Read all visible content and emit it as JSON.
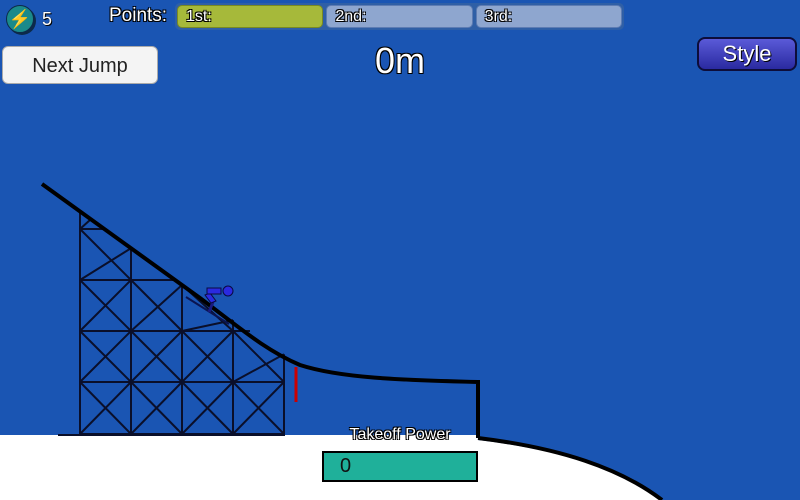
{
  "hud": {
    "energy_icon": "lightning-bolt-icon",
    "energy_glyph": "⚡",
    "energy_count": "5",
    "points_label": "Points:",
    "places": [
      {
        "label": "1st:",
        "value": "",
        "active": true
      },
      {
        "label": "2nd:",
        "value": "",
        "active": false
      },
      {
        "label": "3rd:",
        "value": "",
        "active": false
      }
    ],
    "next_jump_label": "Next Jump",
    "distance": "0m",
    "style_label": "Style"
  },
  "takeoff": {
    "label": "Takeoff Power",
    "value": "0"
  },
  "colors": {
    "sky": "#1a55b3",
    "snow": "#ffffff",
    "structure": "#000000",
    "takeoff_marker": "#cc0000",
    "skier": "#2a2ae0",
    "first_place": "#a6b93a",
    "other_place": "#8ea6cf",
    "power_bar": "#1fb09a"
  }
}
